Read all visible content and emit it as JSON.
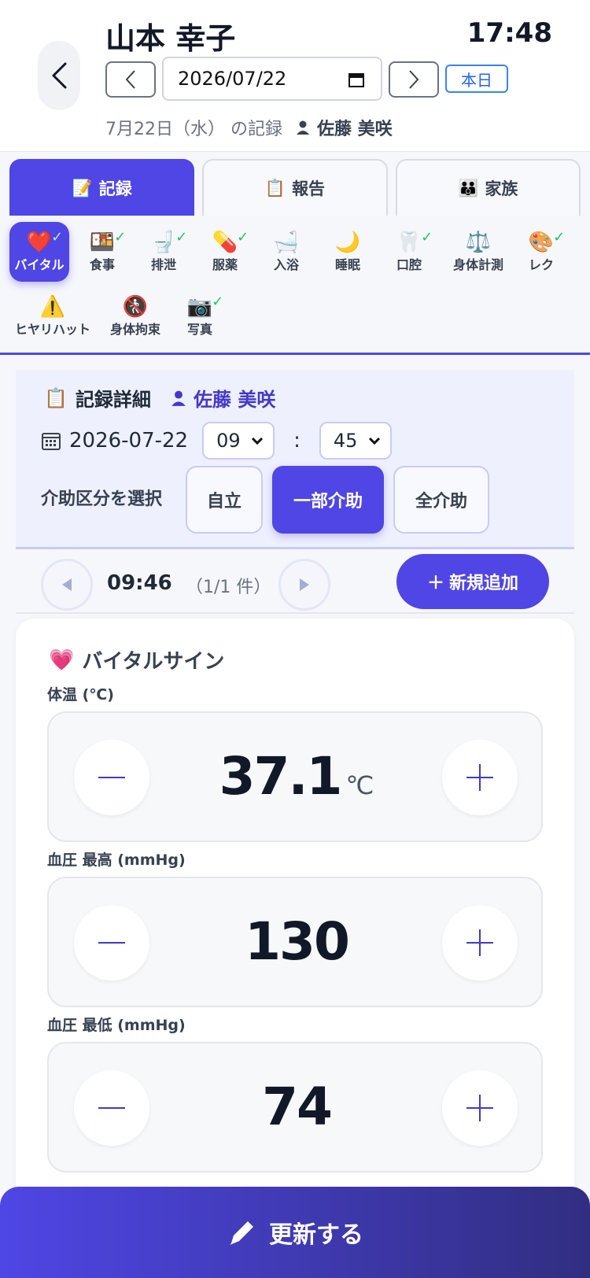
{
  "header": {
    "patient_name": "山本 幸子",
    "clock": "17:48",
    "date_value": "2026/07/22",
    "today_label": "本日",
    "record_date_text": "7月22日（水） の記録",
    "staff_name": "佐藤 美咲"
  },
  "tabs": [
    {
      "icon": "📝",
      "label": "記録",
      "active": true
    },
    {
      "icon": "📋",
      "label": "報告",
      "active": false
    },
    {
      "icon": "👪",
      "label": "家族",
      "active": false
    }
  ],
  "categories": [
    {
      "icon": "❤️",
      "label": "バイタル",
      "checked": true,
      "active": true
    },
    {
      "icon": "🍱",
      "label": "食事",
      "checked": true
    },
    {
      "icon": "🚽",
      "label": "排泄",
      "checked": true
    },
    {
      "icon": "💊",
      "label": "服薬",
      "checked": true
    },
    {
      "icon": "🛁",
      "label": "入浴",
      "checked": false
    },
    {
      "icon": "🌙",
      "label": "睡眠",
      "checked": false
    },
    {
      "icon": "🦷",
      "label": "口腔",
      "checked": true
    },
    {
      "icon": "⚖️",
      "label": "身体計測",
      "checked": false
    },
    {
      "icon": "🎨",
      "label": "レク",
      "checked": true
    },
    {
      "icon": "⚠️",
      "label": "ヒヤリハット",
      "checked": false
    },
    {
      "icon": "🚷",
      "label": "身体拘束",
      "checked": false
    },
    {
      "icon": "📷",
      "label": "写真",
      "checked": true
    }
  ],
  "detail": {
    "title": "記録詳細",
    "staff_name": "佐藤 美咲",
    "date": "2026-07-22",
    "hour": "09",
    "minute": "45",
    "colon": ":",
    "assist_label": "介助区分を選択",
    "assist_options": [
      "自立",
      "一部介助",
      "全介助"
    ],
    "assist_selected": "一部介助"
  },
  "entry_nav": {
    "time": "09:46",
    "count": "（1/1 件）",
    "add_label": "新規追加"
  },
  "vital": {
    "title": "バイタルサイン",
    "fields": [
      {
        "label": "体温 (℃)",
        "value": "37.1",
        "unit": "℃"
      },
      {
        "label": "血圧 最高 (mmHg)",
        "value": "130",
        "unit": ""
      },
      {
        "label": "血圧 最低 (mmHg)",
        "value": "74",
        "unit": ""
      }
    ]
  },
  "footer": {
    "update_label": "更新する"
  }
}
